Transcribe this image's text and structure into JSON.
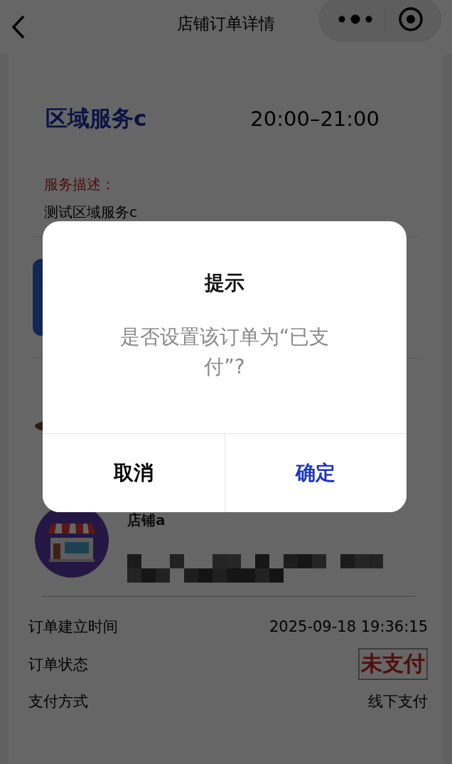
{
  "nav_bar": {
    "title": "店铺订单详情"
  },
  "order": {
    "service_name": "区域服务c",
    "time_slot": "20:00–21:00",
    "description_label": "服务描述：",
    "description": "测试区域服务c"
  },
  "store": {
    "name": "店铺a"
  },
  "details": [
    {
      "label": "订单建立时间",
      "value": "2025-09-18 19:36:15",
      "kind": "plain"
    },
    {
      "label": "订单状态",
      "value": "未支付",
      "kind": "status"
    },
    {
      "label": "支付方式",
      "value": "线下支付",
      "kind": "plain"
    }
  ],
  "dialog": {
    "title": "提示",
    "message": "是否设置该订单为“已支付”?",
    "buttons": [
      {
        "label": "取消",
        "kind": "cancel"
      },
      {
        "label": "确定",
        "kind": "confirm"
      }
    ]
  }
}
